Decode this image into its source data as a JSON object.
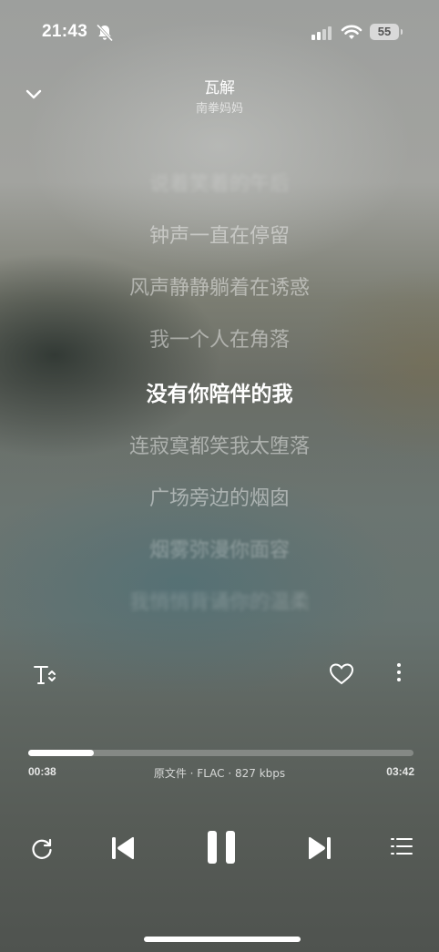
{
  "status": {
    "time": "21:43",
    "battery": "55"
  },
  "player": {
    "title": "瓦解",
    "artist": "南拳妈妈"
  },
  "lyrics": [
    "说着笑着的午后",
    "钟声一直在停留",
    "风声静静躺着在诱惑",
    "我一个人在角落",
    "没有你陪伴的我",
    "连寂寞都笑我太堕落",
    "广场旁边的烟囱",
    "烟雾弥漫你面容",
    "我悄悄背诵你的温柔"
  ],
  "current_lyric_index": 4,
  "progress": {
    "elapsed": "00:38",
    "total": "03:42",
    "fraction": 0.171,
    "audio_info": "原文件 · FLAC · 827 kbps"
  },
  "icons": {
    "collapse": "chevron-down-icon",
    "lyrics_font": "text-size-icon",
    "favorite": "heart-outline-icon",
    "more": "more-vertical-icon",
    "repeat": "repeat-icon",
    "previous": "skip-previous-icon",
    "play_pause": "pause-icon",
    "next": "skip-next-icon",
    "playlist": "playlist-icon"
  }
}
